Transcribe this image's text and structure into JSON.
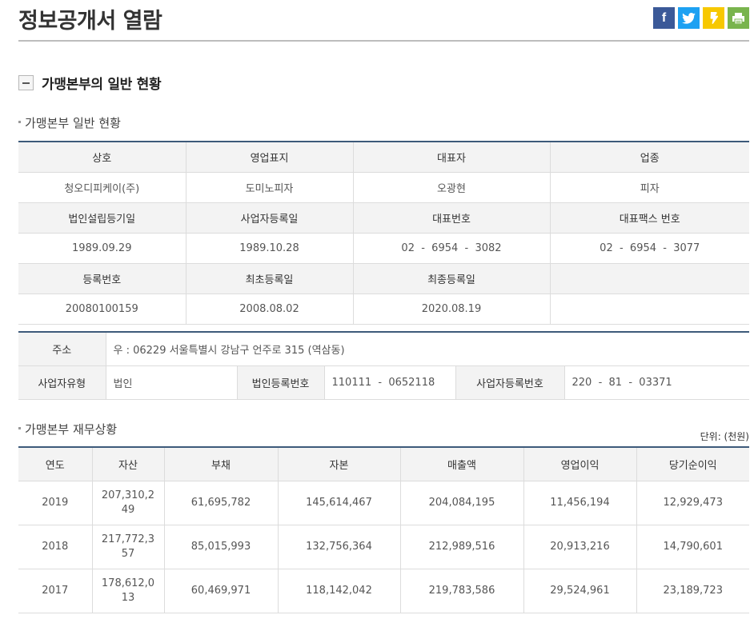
{
  "page": {
    "title": "정보공개서 열람",
    "share": [
      {
        "name": "facebook-icon",
        "label": "f",
        "color": "#3b5998"
      },
      {
        "name": "twitter-icon",
        "label": "",
        "color": "#1da1f2"
      },
      {
        "name": "kakaostory-icon",
        "label": "",
        "color": "#f7c800"
      },
      {
        "name": "print-icon",
        "label": "",
        "color": "#79b44d"
      }
    ]
  },
  "section": {
    "title": "가맹본부의 일반 현황"
  },
  "general": {
    "subtitle": "가맹본부 일반 현황",
    "row1_headers": [
      "상호",
      "영업표지",
      "대표자",
      "업종"
    ],
    "row1_values": [
      "청오디피케이(주)",
      "도미노피자",
      "오광현",
      "피자"
    ],
    "row2_headers": [
      "법인설립등기일",
      "사업자등록일",
      "대표번호",
      "대표팩스 번호"
    ],
    "row2_values": [
      "1989.09.29",
      "1989.10.28",
      "02  -  6954  -  3082",
      "02  -  6954  -  3077"
    ],
    "row3_headers": [
      "등록번호",
      "최초등록일",
      "최종등록일",
      ""
    ],
    "row3_values": [
      "20080100159",
      "2008.08.02",
      "2020.08.19",
      ""
    ]
  },
  "address": {
    "address_label": "주소",
    "address_value": "우 : 06229 서울특별시 강남구 언주로 315 (역삼동)",
    "biz_type_label": "사업자유형",
    "biz_type_value": "법인",
    "corp_no_label": "법인등록번호",
    "corp_no_value": "110111  -  0652118",
    "biz_no_label": "사업자등록번호",
    "biz_no_value": "220  -  81  -  03371"
  },
  "finance": {
    "subtitle": "가맹본부 재무상황",
    "unit": "단위: (천원)",
    "headers": [
      "연도",
      "자산",
      "부채",
      "자본",
      "매출액",
      "영업이익",
      "당기순이익"
    ],
    "rows": [
      [
        "2019",
        "207,310,249",
        "61,695,782",
        "145,614,467",
        "204,084,195",
        "11,456,194",
        "12,929,473"
      ],
      [
        "2018",
        "217,772,357",
        "85,015,993",
        "132,756,364",
        "212,989,516",
        "20,913,216",
        "14,790,601"
      ],
      [
        "2017",
        "178,612,013",
        "60,469,971",
        "118,142,042",
        "219,783,586",
        "29,524,961",
        "23,189,723"
      ]
    ]
  }
}
